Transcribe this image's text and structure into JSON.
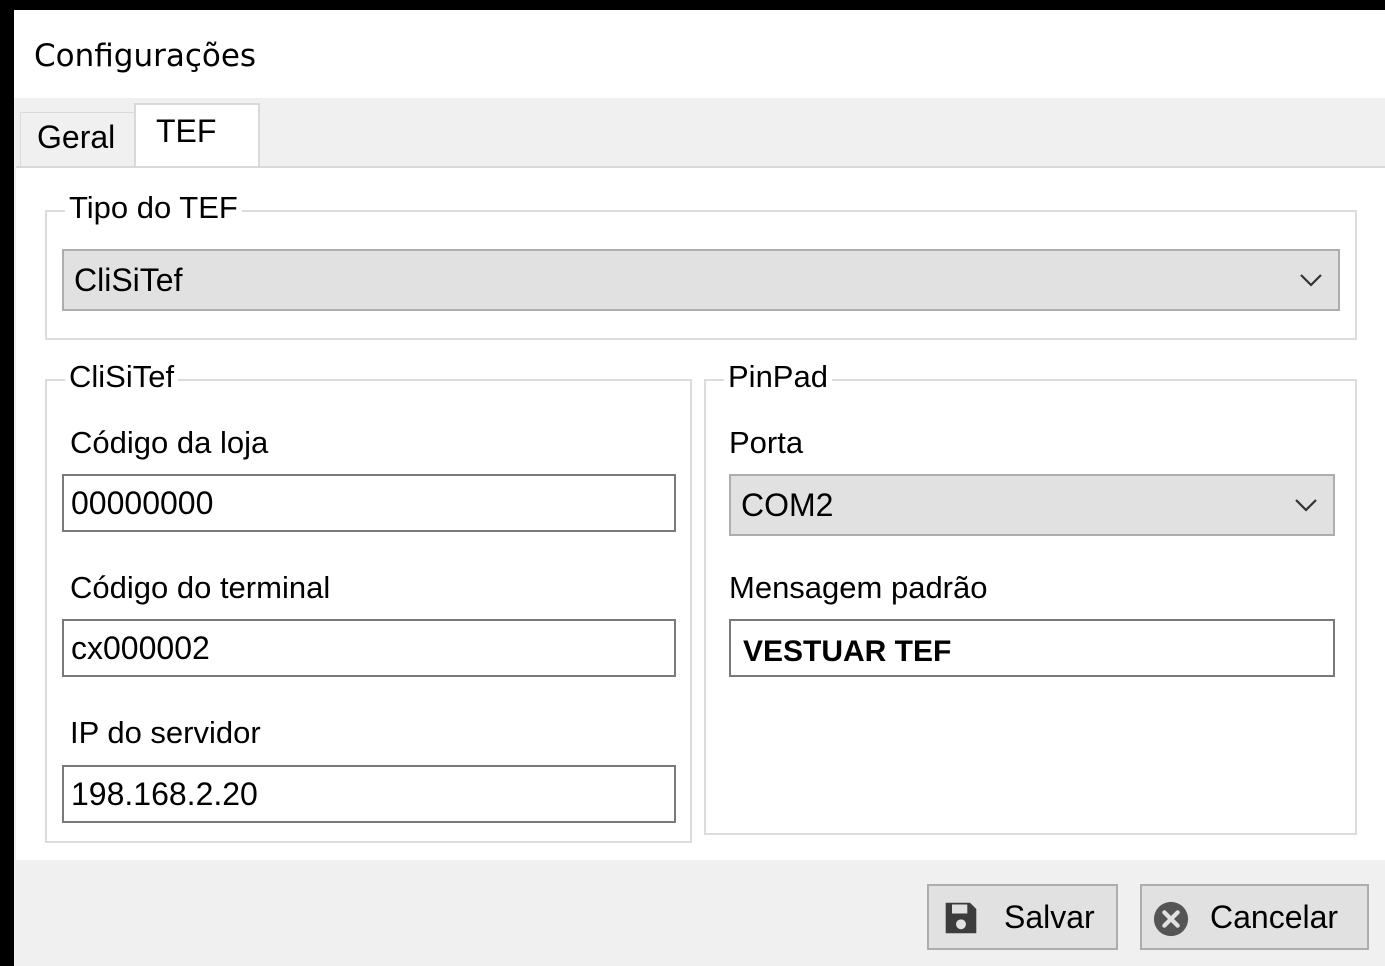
{
  "window": {
    "title": "Configurações"
  },
  "tabs": [
    {
      "label": "Geral"
    },
    {
      "label": "TEF"
    }
  ],
  "tipo_tef": {
    "legend": "Tipo do TEF",
    "selected": "CliSiTef"
  },
  "clisitef": {
    "legend": "CliSiTef",
    "codigo_loja": {
      "label": "Código da loja",
      "value": "00000000"
    },
    "codigo_terminal": {
      "label": "Código do terminal",
      "value": "cx000002"
    },
    "ip_servidor": {
      "label": "IP do servidor",
      "value": "198.168.2.20"
    }
  },
  "pinpad": {
    "legend": "PinPad",
    "porta": {
      "label": "Porta",
      "selected": "COM2"
    },
    "mensagem": {
      "label": "Mensagem padrão",
      "value": "VESTUAR TEF"
    }
  },
  "buttons": {
    "save": {
      "label": "Salvar",
      "icon": "save-icon"
    },
    "cancel": {
      "label": "Cancelar",
      "icon": "cancel-icon"
    }
  }
}
